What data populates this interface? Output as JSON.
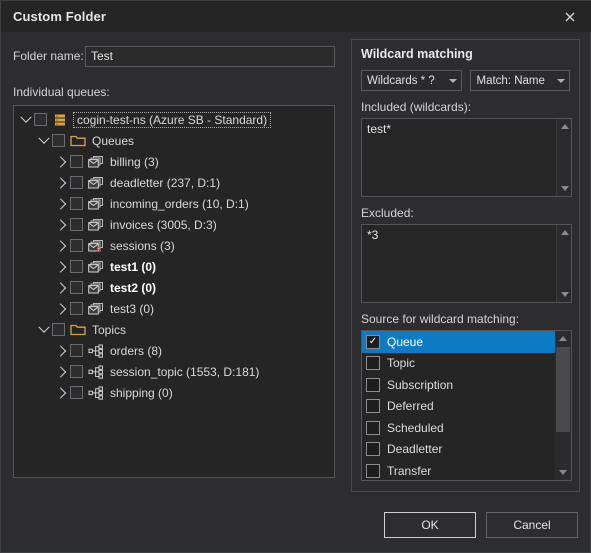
{
  "window": {
    "title": "Custom Folder",
    "close_icon": "close-icon"
  },
  "left": {
    "folder_name_label": "Folder name:",
    "folder_name_value": "Test",
    "folder_name_placeholder": "",
    "individual_queues_label": "Individual queues:",
    "tree": [
      {
        "id": "ns",
        "label": "cogin-test-ns (Azure SB - Standard)",
        "indent": 1,
        "twisty": "open",
        "icon": "namespace-icon",
        "bold": false,
        "selected": true,
        "checked": false
      },
      {
        "id": "queues",
        "label": "Queues",
        "indent": 2,
        "twisty": "open",
        "icon": "folder-icon",
        "bold": false,
        "selected": false,
        "checked": false
      },
      {
        "id": "billing",
        "label": "billing (3)",
        "indent": 3,
        "twisty": "closed",
        "icon": "queue-icon",
        "bold": false,
        "selected": false,
        "checked": false
      },
      {
        "id": "deadletter",
        "label": "deadletter (237, D:1)",
        "indent": 3,
        "twisty": "closed",
        "icon": "queue-icon",
        "bold": false,
        "selected": false,
        "checked": false
      },
      {
        "id": "incoming_orders",
        "label": "incoming_orders (10, D:1)",
        "indent": 3,
        "twisty": "closed",
        "icon": "queue-icon",
        "bold": false,
        "selected": false,
        "checked": false
      },
      {
        "id": "invoices",
        "label": "invoices (3005, D:3)",
        "indent": 3,
        "twisty": "closed",
        "icon": "queue-icon",
        "bold": false,
        "selected": false,
        "checked": false
      },
      {
        "id": "sessions",
        "label": "sessions (3)",
        "indent": 3,
        "twisty": "closed",
        "icon": "session-queue-icon",
        "bold": false,
        "selected": false,
        "checked": false
      },
      {
        "id": "test1",
        "label": "test1 (0)",
        "indent": 3,
        "twisty": "closed",
        "icon": "queue-icon",
        "bold": true,
        "selected": false,
        "checked": false
      },
      {
        "id": "test2",
        "label": "test2 (0)",
        "indent": 3,
        "twisty": "closed",
        "icon": "queue-icon",
        "bold": true,
        "selected": false,
        "checked": false
      },
      {
        "id": "test3",
        "label": "test3 (0)",
        "indent": 3,
        "twisty": "closed",
        "icon": "queue-icon",
        "bold": false,
        "selected": false,
        "checked": false
      },
      {
        "id": "topics",
        "label": "Topics",
        "indent": 2,
        "twisty": "open",
        "icon": "folder-icon",
        "bold": false,
        "selected": false,
        "checked": false
      },
      {
        "id": "orders",
        "label": "orders (8)",
        "indent": 3,
        "twisty": "closed",
        "icon": "topic-icon",
        "bold": false,
        "selected": false,
        "checked": false
      },
      {
        "id": "session_topic",
        "label": "session_topic (1553, D:181)",
        "indent": 3,
        "twisty": "closed",
        "icon": "topic-icon",
        "bold": false,
        "selected": false,
        "checked": false
      },
      {
        "id": "shipping",
        "label": "shipping (0)",
        "indent": 3,
        "twisty": "closed",
        "icon": "topic-icon",
        "bold": false,
        "selected": false,
        "checked": false
      }
    ]
  },
  "right": {
    "group_title": "Wildcard matching",
    "wildcards_combo": {
      "value": "Wildcards * ?",
      "options": [
        "Wildcards * ?"
      ]
    },
    "match_combo": {
      "value": "Match: Name",
      "options": [
        "Match: Name"
      ]
    },
    "included_label": "Included (wildcards):",
    "included_value": "test*",
    "excluded_label": "Excluded:",
    "excluded_value": "*3",
    "source_label": "Source for wildcard matching:",
    "source_items": [
      {
        "label": "Queue",
        "checked": true,
        "selected": true
      },
      {
        "label": "Topic",
        "checked": false,
        "selected": false
      },
      {
        "label": "Subscription",
        "checked": false,
        "selected": false
      },
      {
        "label": "Deferred",
        "checked": false,
        "selected": false
      },
      {
        "label": "Scheduled",
        "checked": false,
        "selected": false
      },
      {
        "label": "Deadletter",
        "checked": false,
        "selected": false
      },
      {
        "label": "Transfer",
        "checked": false,
        "selected": false
      }
    ],
    "check_glyph": "✓"
  },
  "footer": {
    "ok_label": "OK",
    "cancel_label": "Cancel"
  },
  "colors": {
    "dialog_bg": "#2d2d30",
    "titlebar_bg": "#252526",
    "panel_bg": "#252526",
    "accent_selection": "#0d7bc4",
    "folder_icon": "#d9a544",
    "session_badge": "#e05a5a"
  }
}
